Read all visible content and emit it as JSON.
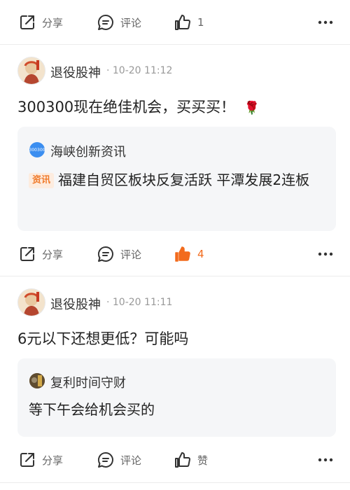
{
  "post0": {
    "actions": {
      "share": "分享",
      "comment": "评论",
      "like_count": "1"
    }
  },
  "post1": {
    "author": "退役股神",
    "meta": "· 10-20 11:12",
    "text": "300300现在绝佳机会，买买买！",
    "emoji": "🌹",
    "quote": {
      "source": "海峡创新资讯",
      "source_badge": "300300",
      "tag": "资讯",
      "text": "福建自贸区板块反复活跃 平潭发展2连板"
    },
    "actions": {
      "share": "分享",
      "comment": "评论",
      "like_count": "4"
    }
  },
  "post2": {
    "author": "退役股神",
    "meta": "· 10-20 11:11",
    "text": "6元以下还想更低？可能吗",
    "quote": {
      "source": "复利时间守财",
      "text": "等下午会给机会买的"
    },
    "actions": {
      "share": "分享",
      "comment": "评论",
      "like": "赞"
    }
  },
  "colors": {
    "accent": "#f26b1d",
    "quote_bg": "#f5f6f8",
    "muted": "#999999"
  },
  "icons": [
    "share-icon",
    "comment-icon",
    "thumbs-up-icon",
    "more-icon",
    "rose-emoji"
  ]
}
